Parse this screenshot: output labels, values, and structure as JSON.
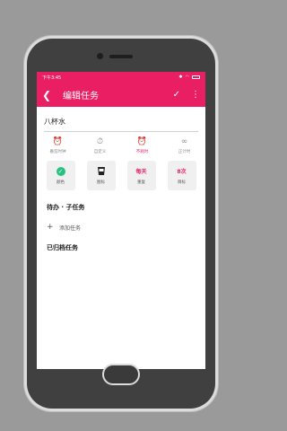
{
  "status": {
    "time": "下午3:45"
  },
  "toolbar": {
    "title": "编辑任务",
    "back_icon": "back-arrow-icon",
    "confirm_icon": "check-icon",
    "more_icon": "more-vert-icon"
  },
  "task": {
    "name": "八杯水"
  },
  "options": [
    {
      "label": "番茄时钟",
      "icon": "alarm-icon",
      "active": false
    },
    {
      "label": "自定义",
      "icon": "timer-icon",
      "active": false
    },
    {
      "label": "不耗时",
      "icon": "alarm-off-icon",
      "active": true
    },
    {
      "label": "正计时",
      "icon": "infinity-icon",
      "active": false
    }
  ],
  "tiles": [
    {
      "top": "",
      "label": "颜色",
      "icon": "check-circle-icon"
    },
    {
      "top": "",
      "label": "图标",
      "icon": "cup-icon"
    },
    {
      "top": "每天",
      "label": "重复"
    },
    {
      "top": "8次",
      "label": "目标"
    }
  ],
  "sections": {
    "todo": "待办 · 子任务",
    "add_task": "添加任务",
    "archived": "已归档任务"
  },
  "colors": {
    "accent": "#e91e63",
    "check_green": "#26c281"
  }
}
